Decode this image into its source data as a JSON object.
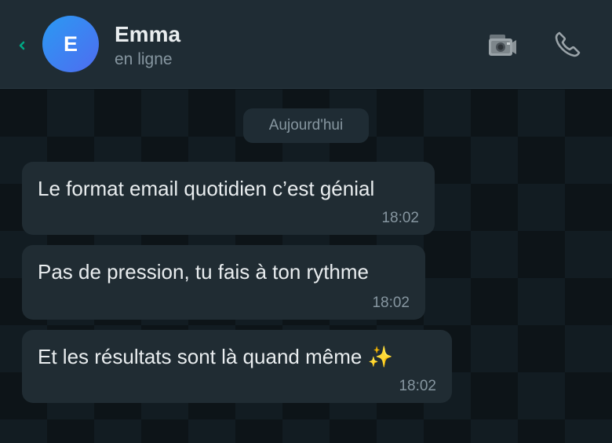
{
  "header": {
    "back_icon": "chevron-left-icon",
    "avatar_initial": "E",
    "contact_name": "Emma",
    "contact_status": "en ligne",
    "video_icon": "video-camera-icon",
    "call_icon": "phone-icon"
  },
  "chat": {
    "date_label": "Aujourd'hui",
    "messages": [
      {
        "text": "Le format email quotidien c’est génial",
        "time": "18:02"
      },
      {
        "text": "Pas de pression, tu fais à ton rythme",
        "time": "18:02"
      },
      {
        "text": "Et les résultats sont là quand même ✨",
        "time": "18:02"
      }
    ]
  },
  "colors": {
    "header_bg": "#1f2c34",
    "chat_bg": "#0d1418",
    "bubble_bg": "#202c33",
    "accent": "#00a884",
    "text_primary": "#e9edef",
    "text_secondary": "#8696a0"
  }
}
